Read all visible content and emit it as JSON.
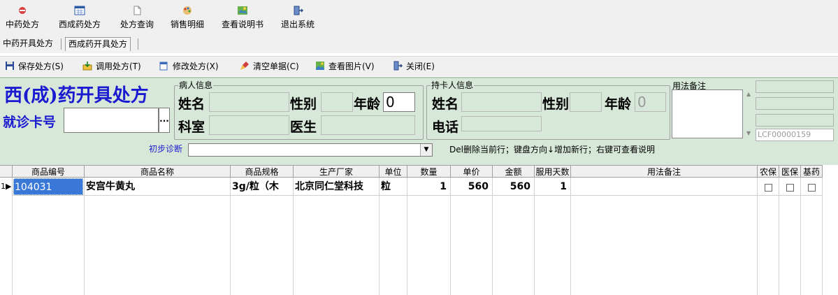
{
  "toolbar": {
    "items": [
      {
        "label": "中药处方",
        "icon": "herbal-prescription-icon"
      },
      {
        "label": "西成药处方",
        "icon": "calendar-icon"
      },
      {
        "label": "处方查询",
        "icon": "document-icon"
      },
      {
        "label": "销售明细",
        "icon": "palette-icon"
      },
      {
        "label": "查看说明书",
        "icon": "map-icon"
      },
      {
        "label": "退出系统",
        "icon": "exit-door-icon"
      }
    ]
  },
  "module_tabs": {
    "tabs": [
      {
        "label": "中药开具处方",
        "active": false
      },
      {
        "label": "西成药开具处方",
        "active": true
      }
    ]
  },
  "actions": {
    "items": [
      {
        "label": "保存处方(S)",
        "icon": "save-icon"
      },
      {
        "label": "调用处方(T)",
        "icon": "import-icon"
      },
      {
        "label": "修改处方(X)",
        "icon": "edit-icon"
      },
      {
        "label": "清空单据(C)",
        "icon": "clear-brush-icon"
      },
      {
        "label": "查看图片(V)",
        "icon": "picture-icon"
      },
      {
        "label": "关闭(E)",
        "icon": "close-door-icon"
      }
    ]
  },
  "form": {
    "title": "西(成)药开具处方",
    "card_no_label": "就诊卡号",
    "card_no_value": "",
    "browse_button": "...",
    "patient": {
      "group_title": "病人信息",
      "name_label": "姓名",
      "name_value": "",
      "gender_label": "性别",
      "gender_value": "",
      "age_label": "年龄",
      "age_value": "0",
      "dept_label": "科室",
      "dept_value": "",
      "doctor_label": "医生",
      "doctor_value": ""
    },
    "cardholder": {
      "group_title": "持卡人信息",
      "name_label": "姓名",
      "name_value": "",
      "gender_label": "性别",
      "gender_value": "",
      "age_label": "年龄",
      "age_value": "0",
      "phone_label": "电话",
      "phone_value": ""
    },
    "usage_note_label": "用法备注",
    "usage_note_value": "",
    "side_fields": [
      "",
      "",
      ""
    ],
    "doc_code": "LCF00000159",
    "diagnosis_label": "初步诊断",
    "diagnosis_value": "",
    "hint": "Del删除当前行；键盘方向↓增加新行；右键可查看说明"
  },
  "grid": {
    "columns": [
      "商品编号",
      "商品名称",
      "商品规格",
      "生产厂家",
      "单位",
      "数量",
      "单价",
      "金额",
      "服用天数",
      "用法备注",
      "农保",
      "医保",
      "基药"
    ],
    "rows": [
      {
        "row_no": "1",
        "code": "104031",
        "name": "安宫牛黄丸",
        "spec": "3g/粒（木",
        "maker": "北京同仁堂科技",
        "unit": "粒",
        "qty": "1",
        "price": "560",
        "amount": "560",
        "days": "1",
        "note": "",
        "nongbao": false,
        "yibao": false,
        "jiyao": false
      }
    ]
  }
}
